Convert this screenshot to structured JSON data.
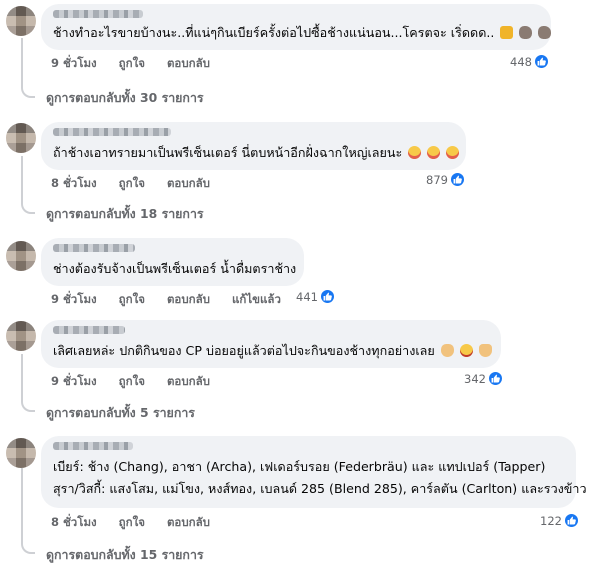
{
  "comments": [
    {
      "text_lines": [
        "ช้างทำอะไรขายบ้างนะ..ที่แน่ๆกินเบียร์ครั้งต่อไปซื้อช้างแน่นอน...โครตจะ เริ่ดดด.."
      ],
      "emojis": [
        "beer",
        "elephant",
        "elephant"
      ],
      "time": "9 ชั่วโมง",
      "like": "ถูกใจ",
      "reply": "ตอบกลับ",
      "edited": "",
      "reaction_count": "448",
      "replies_label": "ดูการตอบกลับทั้ง 30 รายการ"
    },
    {
      "text_lines": [
        "ถ้าช้างเอาทรายมาเป็นพรีเซ็นเตอร์ นี่ตบหน้าอีกฝั่งฉากใหญ่เลยนะ"
      ],
      "emojis": [
        "laugh",
        "laugh",
        "laugh"
      ],
      "time": "8 ชั่วโมง",
      "like": "ถูกใจ",
      "reply": "ตอบกลับ",
      "edited": "",
      "reaction_count": "879",
      "replies_label": "ดูการตอบกลับทั้ง 18 รายการ"
    },
    {
      "text_lines": [
        "ช่างต้องรับจ้างเป็นพรีเซ็นเตอร์ น้ำดื่มตราช้าง"
      ],
      "emojis": [],
      "time": "9 ชั่วโมง",
      "like": "ถูกใจ",
      "reply": "ตอบกลับ",
      "edited": "แก้ไขแล้ว",
      "reaction_count": "441",
      "replies_label": ""
    },
    {
      "text_lines": [
        "เลิศเลยหล่ะ ปกติกินของ CP บ่อยอยู่แล้วต่อไปจะกินของช้างทุกอย่างเลย"
      ],
      "emojis": [
        "ok-hand",
        "astonished",
        "peace"
      ],
      "time": "9 ชั่วโมง",
      "like": "ถูกใจ",
      "reply": "ตอบกลับ",
      "edited": "",
      "reaction_count": "342",
      "replies_label": "ดูการตอบกลับทั้ง 5 รายการ"
    },
    {
      "text_lines": [
        "เบียร์: ช้าง (Chang), อาชา (Archa), เฟเดอร์บรอย (Federbräu) และ แทปเปอร์ (Tapper)",
        "สุรา/วิสกี้: แสงโสม, แม่โขง, หงส์ทอง, เบลนด์ 285 (Blend 285), คาร์ลตัน (Carlton) และรวงข้าว"
      ],
      "emojis": [],
      "time": "8 ชั่วโมง",
      "like": "ถูกใจ",
      "reply": "ตอบกลับ",
      "edited": "",
      "reaction_count": "122",
      "replies_label": "ดูการตอบกลับทั้ง 15 รายการ"
    }
  ],
  "colors": {
    "bubble": "#f0f2f5",
    "meta_text": "#65676b",
    "like_blue": "#1877f2",
    "thread_line": "#ced0d4"
  },
  "icons": {
    "reaction": "like-thumb-icon",
    "avatar": "blurred-avatar"
  }
}
